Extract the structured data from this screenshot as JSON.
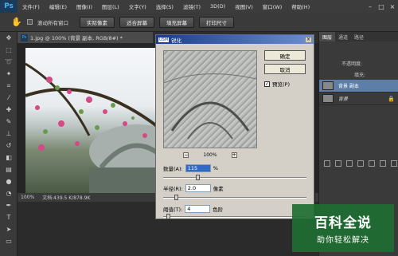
{
  "menubar": {
    "logo": "Ps",
    "items": [
      "文件(F)",
      "编辑(E)",
      "图像(I)",
      "图层(L)",
      "文字(Y)",
      "选择(S)",
      "滤镜(T)",
      "3D(D)",
      "视图(V)",
      "窗口(W)",
      "帮助(H)"
    ],
    "controls": [
      "–",
      "□",
      "×"
    ]
  },
  "optbar": {
    "checkbox_label": "滚动所有窗口",
    "buttons": [
      "实际像素",
      "适合屏幕",
      "填充屏幕",
      "打印尺寸"
    ]
  },
  "document": {
    "tab_icon": "Ps",
    "tab_title": "1.jpg @ 100% (背景 副本, RGB/8#) *",
    "status_zoom": "100%",
    "status_doc": "文档:439.5 K/878.9K"
  },
  "right_panel": {
    "tabs": [
      "图层",
      "通道",
      "路径"
    ],
    "opacity_label": "不透明度:",
    "fill_label": "填充:",
    "layers": [
      {
        "name": "背景 副本",
        "selected": true
      },
      {
        "name": "背景",
        "selected": false
      }
    ]
  },
  "dialog": {
    "title": "锐化",
    "title_badge": "USM",
    "close": "×",
    "ok": "确定",
    "cancel": "取消",
    "preview_label": "预览(P)",
    "preview_checked": true,
    "zoom_minus": "−",
    "zoom_plus": "+",
    "zoom": "100%",
    "amount_label": "数量(A):",
    "amount_value": "115",
    "amount_unit": "%",
    "radius_label": "半径(R):",
    "radius_value": "2.0",
    "radius_unit": "像素",
    "threshold_label": "阈值(T):",
    "threshold_value": "4",
    "threshold_unit": "色阶",
    "amount_level": 0.23,
    "radius_level": 0.08,
    "threshold_level": 0.02
  },
  "watermark": {
    "big": "百科全说",
    "small": "助你轻松解决"
  },
  "colors": {
    "ps_blue": "#4ab0f5",
    "dialog_bg": "#d4d0c8",
    "title_blue": "#1a3d8a",
    "layer_selected": "#5d7ea8",
    "watermark_green": "#1e6e32"
  }
}
